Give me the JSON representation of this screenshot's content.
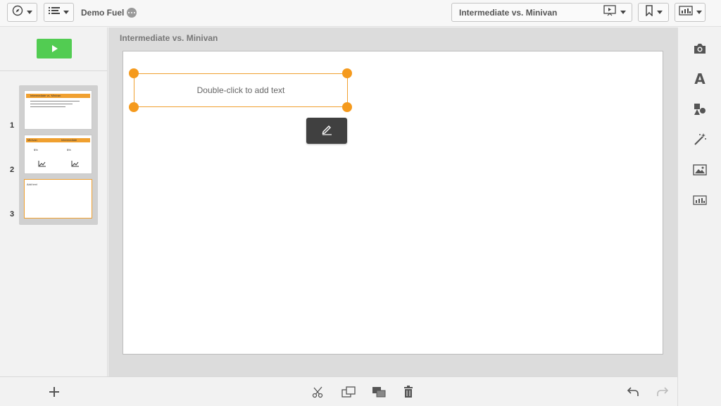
{
  "toolbar": {
    "app_title": "Demo Fuel",
    "story_title": "Intermediate vs. Minivan"
  },
  "slides": [
    {
      "number": "1",
      "thumb_title": "Intermediate vs. Minivan"
    },
    {
      "number": "2",
      "thumb_col1": "Minivan",
      "thumb_col2": "Intermediate",
      "thumb_val1": "$%",
      "thumb_val2": "$%"
    },
    {
      "number": "3",
      "thumb_text": "Add text"
    }
  ],
  "canvas": {
    "slide_title": "Intermediate vs. Minivan",
    "textbox_placeholder": "Double-click to add text"
  },
  "colors": {
    "accent": "#f59a1d",
    "play": "#52cc52",
    "edit_button": "#404040"
  },
  "icons": {
    "toolbar": [
      "compass-icon",
      "list-icon",
      "presentation-icon",
      "bookmark-icon",
      "sheet-icon"
    ],
    "right_panel": [
      "camera-icon",
      "text-icon",
      "shapes-icon",
      "effects-icon",
      "image-icon",
      "sheet-icon"
    ],
    "bottom": [
      "cut-icon",
      "copy-icon",
      "layer-icon",
      "delete-icon",
      "undo-icon",
      "redo-icon"
    ]
  },
  "right_panel": {
    "text_tool_glyph": "A"
  }
}
